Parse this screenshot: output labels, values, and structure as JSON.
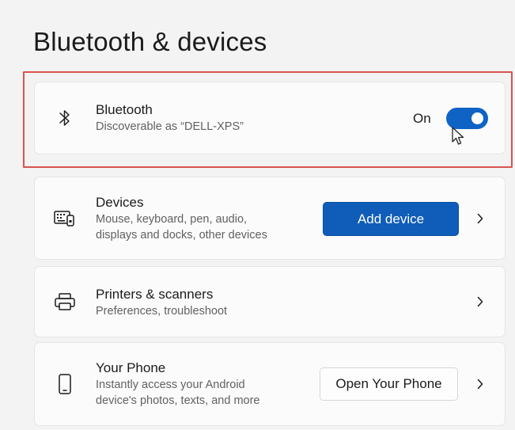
{
  "page": {
    "title": "Bluetooth & devices"
  },
  "bluetooth": {
    "title": "Bluetooth",
    "subtitle": "Discoverable as “DELL-XPS”",
    "state_label": "On",
    "toggle_on": true,
    "icon": "bluetooth-icon"
  },
  "devices": {
    "title": "Devices",
    "subtitle_line1": "Mouse, keyboard, pen, audio,",
    "subtitle_line2": "displays and docks, other devices",
    "button_label": "Add device",
    "icon": "devices-icon"
  },
  "printers": {
    "title": "Printers & scanners",
    "subtitle": "Preferences, troubleshoot",
    "icon": "printer-icon"
  },
  "phone": {
    "title": "Your Phone",
    "subtitle_line1": "Instantly access your Android",
    "subtitle_line2": "device's photos, texts, and more",
    "button_label": "Open Your Phone",
    "icon": "phone-icon"
  },
  "colors": {
    "accent": "#0f63c5",
    "highlight_border": "#d9534f",
    "background": "#f3f3f3",
    "card": "#fbfbfb"
  }
}
